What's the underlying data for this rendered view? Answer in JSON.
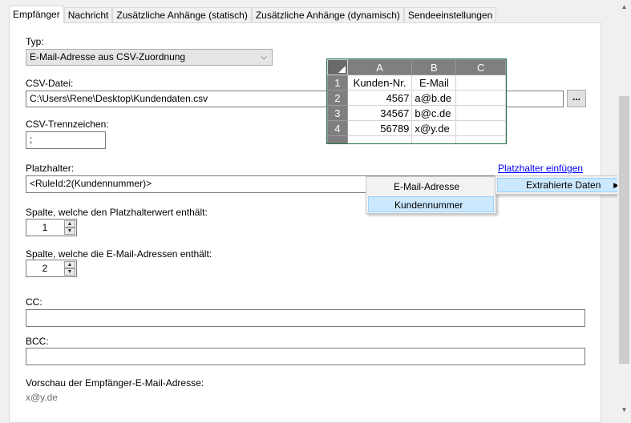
{
  "tabs": [
    "Empfänger",
    "Nachricht",
    "Zusätzliche Anhänge (statisch)",
    "Zusätzliche Anhänge (dynamisch)",
    "Sendeeinstellungen"
  ],
  "form": {
    "type_label": "Typ:",
    "type_value": "E-Mail-Adresse aus CSV-Zuordnung",
    "csv_label": "CSV-Datei:",
    "csv_value": "C:\\Users\\Rene\\Desktop\\Kundendaten.csv",
    "browse_label": "...",
    "separator_label": "CSV-Trennzeichen:",
    "separator_value": ";",
    "placeholder_label": "Platzhalter:",
    "placeholder_link": "Platzhalter einfügen",
    "placeholder_value": "<RuleId:2(Kundennummer)>",
    "placeholder_col_label": "Spalte, welche den Platzhalterwert enthält:",
    "placeholder_col_value": "1",
    "email_col_label": "Spalte, welche die E-Mail-Adressen enthält:",
    "email_col_value": "2",
    "cc_label": "CC:",
    "cc_value": "",
    "bcc_label": "BCC:",
    "bcc_value": "",
    "preview_label": "Vorschau der Empfänger-E-Mail-Adresse:",
    "preview_value": "x@y.de"
  },
  "spreadsheet": {
    "columns": [
      "A",
      "B",
      "C"
    ],
    "rows": [
      {
        "num": "1",
        "a": "Kunden-Nr.",
        "b": "E-Mail",
        "c": ""
      },
      {
        "num": "2",
        "a": "4567",
        "b": "a@b.de",
        "c": ""
      },
      {
        "num": "3",
        "a": "34567",
        "b": "b@c.de",
        "c": ""
      },
      {
        "num": "4",
        "a": "56789",
        "b": "x@y.de",
        "c": ""
      }
    ]
  },
  "context_menu": {
    "items": [
      "E-Mail-Adresse",
      "Kundennummer"
    ],
    "parent_item": "Extrahierte Daten",
    "highlight": "#cce8ff"
  },
  "icons": [
    "dropdown-arrow-icon",
    "spin-up-icon",
    "spin-down-icon",
    "submenu-arrow-icon",
    "scroll-up-icon",
    "scroll-down-icon"
  ]
}
